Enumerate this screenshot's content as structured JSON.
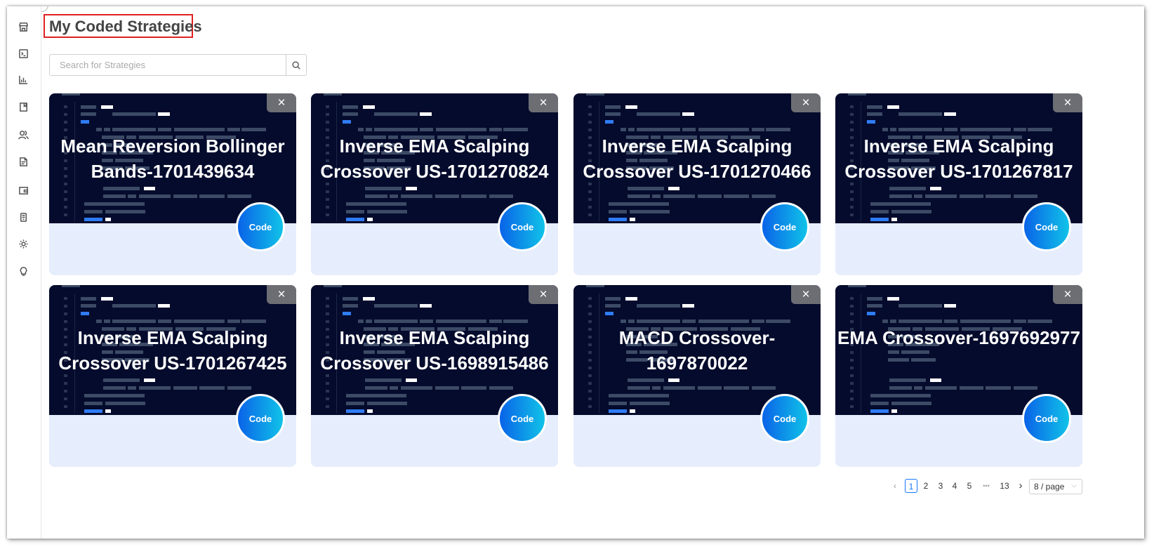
{
  "page_title": "My Coded Strategies",
  "search": {
    "placeholder": "Search for Strategies"
  },
  "sidebar": {
    "icons": [
      "store-icon",
      "terminal-icon",
      "bar-chart-icon",
      "bookmark-icon",
      "users-icon",
      "document-icon",
      "wallet-icon",
      "phone-icon",
      "gear-icon",
      "lightbulb-icon"
    ]
  },
  "strategies": [
    {
      "title": "Mean Reversion Bollinger Bands-1701439634",
      "code_label": "Code",
      "close_label": "×"
    },
    {
      "title": "Inverse EMA Scalping Crossover US-1701270824",
      "code_label": "Code",
      "close_label": "×"
    },
    {
      "title": "Inverse EMA Scalping Crossover US-1701270466",
      "code_label": "Code",
      "close_label": "×"
    },
    {
      "title": "Inverse EMA Scalping Crossover US-1701267817",
      "code_label": "Code",
      "close_label": "×"
    },
    {
      "title": "Inverse EMA Scalping Crossover US-1701267425",
      "code_label": "Code",
      "close_label": "×"
    },
    {
      "title": "Inverse EMA Scalping Crossover US-1698915486",
      "code_label": "Code",
      "close_label": "×"
    },
    {
      "title": "MACD Crossover-1697870022",
      "code_label": "Code",
      "close_label": "×"
    },
    {
      "title": "EMA Crossover-1697692977",
      "code_label": "Code",
      "close_label": "×"
    }
  ],
  "pagination": {
    "prev": "‹",
    "pages": [
      "1",
      "2",
      "3",
      "4",
      "5"
    ],
    "ellipsis": "•••",
    "last_page": "13",
    "next": "›",
    "current": "1",
    "page_size": "8 / page",
    "page_size_chevron": "⌵"
  }
}
